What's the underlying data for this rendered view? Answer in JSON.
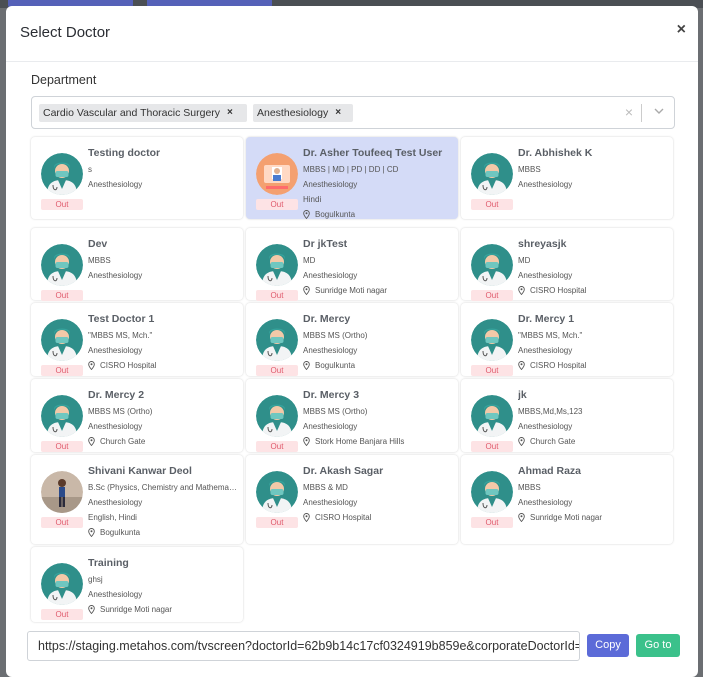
{
  "modal": {
    "title": "Select Doctor",
    "close_label": "×"
  },
  "department": {
    "label": "Department",
    "chips": [
      "Cardio Vascular and Thoracic Surgery",
      "Anesthesiology"
    ],
    "chip_remove": "×",
    "clear_label": "×"
  },
  "status_label": "Out",
  "doctors": [
    {
      "name": "Testing doctor",
      "lines": [
        "s",
        "Anesthesiology"
      ],
      "location": "",
      "avatar": "doctor-avatar-icon"
    },
    {
      "name": "Dr. Asher Toufeeq Test User",
      "lines": [
        "MBBS | MD | PD | DD | CD",
        "Anesthesiology",
        "Hindi"
      ],
      "location": "Bogulkunta",
      "avatar": "doctor-photo-icon"
    },
    {
      "name": "Dr. Abhishek K",
      "lines": [
        "MBBS",
        "Anesthesiology"
      ],
      "location": "",
      "avatar": "doctor-avatar-icon"
    },
    {
      "name": "Dev",
      "lines": [
        "MBBS",
        "Anesthesiology"
      ],
      "location": "",
      "avatar": "doctor-avatar-icon"
    },
    {
      "name": "Dr jkTest",
      "lines": [
        "MD",
        "Anesthesiology"
      ],
      "location": "Sunridge Moti nagar",
      "avatar": "doctor-avatar-icon"
    },
    {
      "name": "shreyasjk",
      "lines": [
        "MD",
        "Anesthesiology"
      ],
      "location": "CISRO Hospital",
      "avatar": "doctor-avatar-icon"
    },
    {
      "name": "Test Doctor 1",
      "lines": [
        "\"MBBS MS, Mch.\"",
        "Anesthesiology"
      ],
      "location": "CISRO Hospital",
      "avatar": "doctor-avatar-icon"
    },
    {
      "name": "Dr. Mercy",
      "lines": [
        "MBBS MS (Ortho)",
        "Anesthesiology"
      ],
      "location": "Bogulkunta",
      "avatar": "doctor-avatar-icon"
    },
    {
      "name": "Dr. Mercy 1",
      "lines": [
        "\"MBBS MS, Mch.\"",
        "Anesthesiology"
      ],
      "location": "CISRO Hospital",
      "avatar": "doctor-avatar-icon"
    },
    {
      "name": "Dr. Mercy 2",
      "lines": [
        "MBBS MS (Ortho)",
        "Anesthesiology"
      ],
      "location": "Church Gate",
      "avatar": "doctor-avatar-icon"
    },
    {
      "name": "Dr. Mercy 3",
      "lines": [
        "MBBS MS (Ortho)",
        "Anesthesiology"
      ],
      "location": "Stork Home Banjara Hills",
      "avatar": "doctor-avatar-icon"
    },
    {
      "name": "jk",
      "lines": [
        "MBBS,Md,Ms,123",
        "Anesthesiology"
      ],
      "location": "Church Gate",
      "avatar": "doctor-avatar-icon"
    },
    {
      "name": "Shivani Kanwar Deol",
      "lines": [
        "B.Sc (Physics, Chemistry and Mathematics)",
        "Anesthesiology",
        "English, Hindi"
      ],
      "location": "Bogulkunta",
      "avatar": "person-photo-icon"
    },
    {
      "name": "Dr. Akash Sagar",
      "lines": [
        "MBBS & MD",
        "Anesthesiology"
      ],
      "location": "CISRO Hospital",
      "avatar": "doctor-avatar-icon"
    },
    {
      "name": "Ahmad Raza",
      "lines": [
        "MBBS",
        "Anesthesiology"
      ],
      "location": "Sunridge Moti nagar",
      "avatar": "doctor-avatar-icon"
    },
    {
      "name": "Training",
      "lines": [
        "ghsj",
        "Anesthesiology"
      ],
      "location": "Sunridge Moti nagar",
      "avatar": "doctor-avatar-icon"
    }
  ],
  "footer": {
    "url": "https://staging.metahos.com/tvscreen?doctorId=62b9b14c17cf0324919b859e&corporateDoctorId=",
    "copy_label": "Copy",
    "goto_label": "Go to"
  },
  "colors": {
    "primary": "#5c6bd8",
    "success": "#3bc18b",
    "out_badge_bg": "#fde3e5",
    "out_badge_text": "#e05a6c",
    "selected_card": "#d4dbf7"
  }
}
